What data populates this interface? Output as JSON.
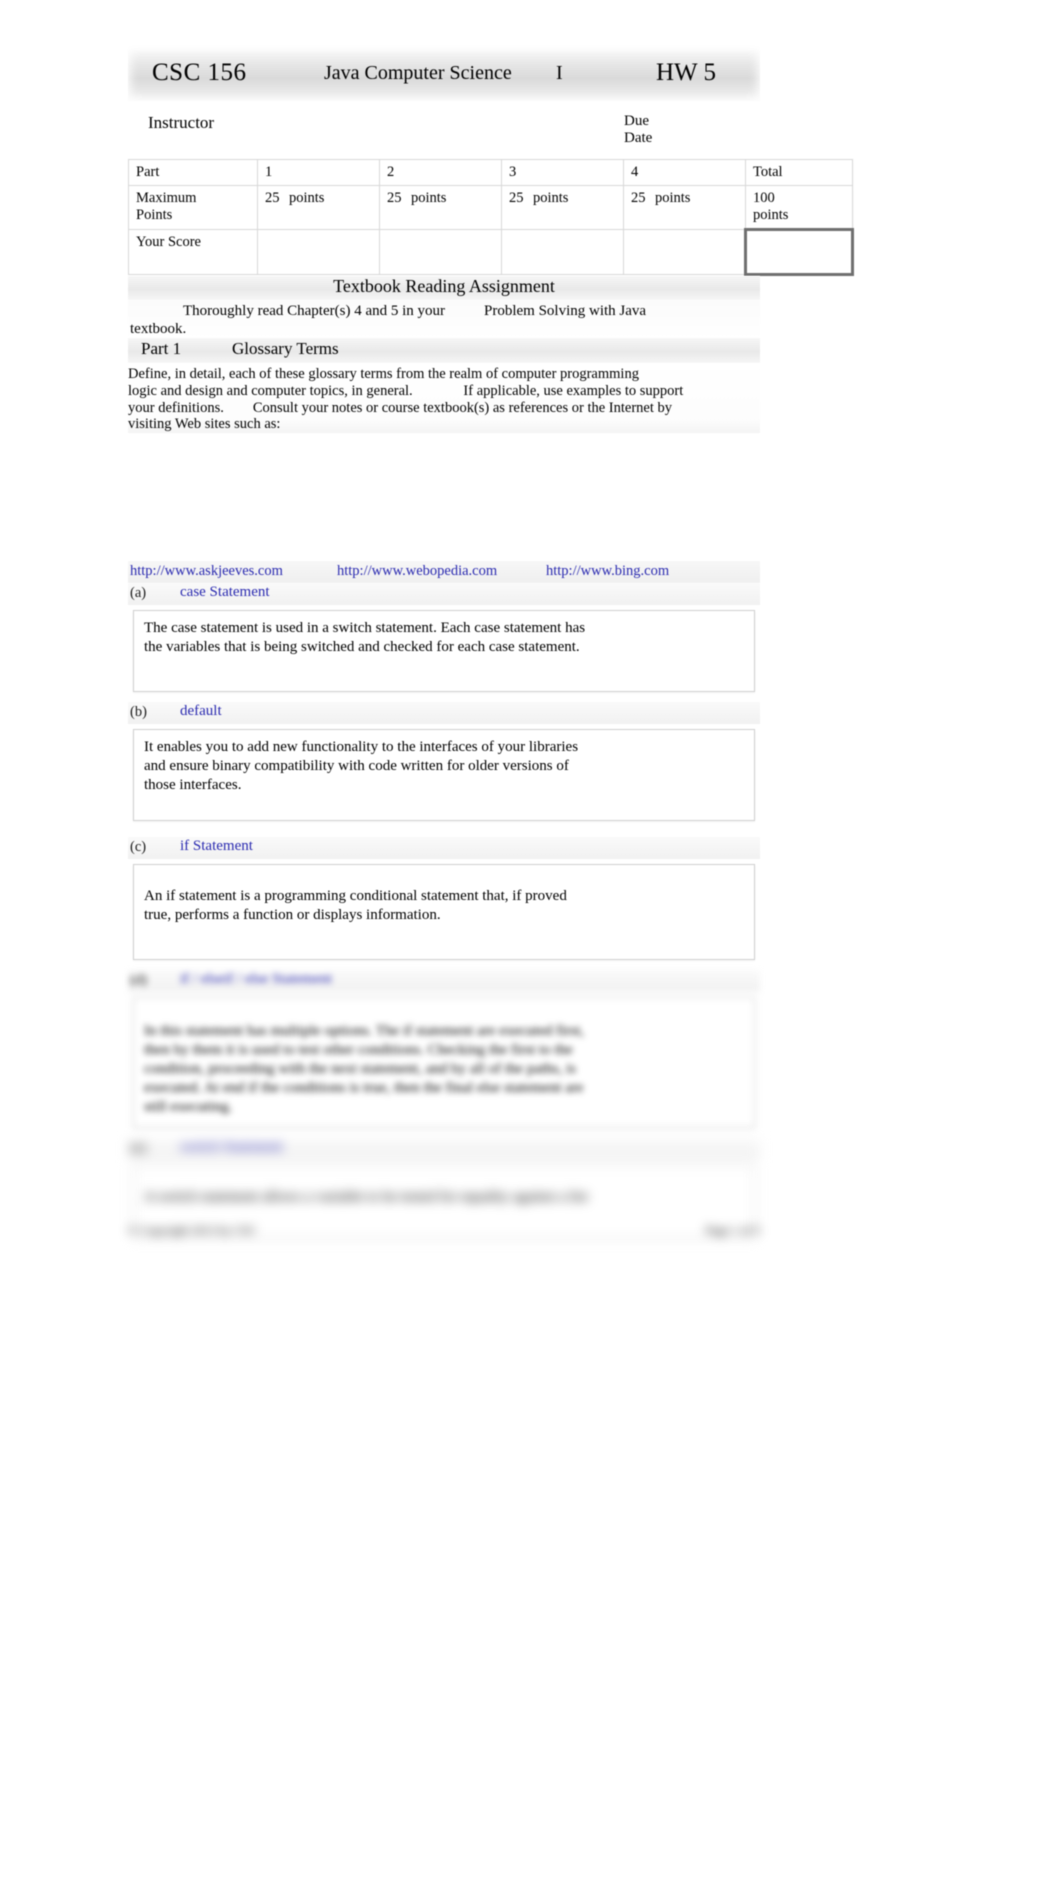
{
  "header": {
    "course_code": "CSC 156",
    "course_name": "Java Computer Science",
    "course_number": "I",
    "assignment": "HW 5"
  },
  "info": {
    "instructor_label": "Instructor",
    "due_label_line1": "Due",
    "due_label_line2": "Date"
  },
  "score_table": {
    "row_part_label": "Part",
    "row_max_label_line1": "Maximum",
    "row_max_label_line2": "Points",
    "row_your_score_label": "Your Score",
    "parts": [
      "1",
      "2",
      "3",
      "4"
    ],
    "points_values": [
      "25",
      "25",
      "25",
      "25"
    ],
    "points_unit": "points",
    "total_label": "Total",
    "total_points_line1": "100",
    "total_points_line2": "points"
  },
  "reading": {
    "banner": "Textbook Reading Assignment",
    "line1": "Thoroughly read Chapter(s) 4 and 5 in your",
    "book_title": "Problem Solving with Java",
    "line2": "textbook."
  },
  "part1": {
    "banner_left": "Part 1",
    "banner_mid": "Glossary Terms",
    "instructions_line1": "Define, in detail, each of these glossary terms from the realm of computer programming",
    "instructions_line2": "logic and design and computer topics, in general.              If applicable, use examples to support",
    "instructions_line3": "your definitions.        Consult your notes or course textbook(s) as references or the Internet by",
    "instructions_line4": "visiting Web sites such as:"
  },
  "urls": [
    "http://www.askjeeves.com",
    "http://www.webopedia.com",
    "http://www.bing.com"
  ],
  "glossary": [
    {
      "letter": "(a)",
      "term": "case Statement",
      "answer_lines": [
        "The case statement is used in a switch statement. Each case statement has",
        "the variables that is being switched and checked for each case statement."
      ]
    },
    {
      "letter": "(b)",
      "term": "default",
      "answer_lines": [
        "It enables you to add new functionality to the interfaces of your libraries",
        "and ensure binary compatibility with code written for older versions of",
        "those interfaces."
      ]
    },
    {
      "letter": "(c)",
      "term": "if Statement",
      "answer_lines": [
        "An if statement is a programming conditional statement that, if proved",
        "true, performs a function or displays information."
      ]
    },
    {
      "letter": "(d)",
      "term": "if / elseif / else Statement",
      "answer_lines": [
        "In this statement has multiple options. The if statement are executed first,",
        "then by them it is used to test other conditions. Checking the first to the",
        "condition, proceeding with the next statement, and by all of the paths, is",
        "executed. At end if the conditions is true, then the final else statement are",
        "still executing."
      ]
    },
    {
      "letter": "(e)",
      "term": "switch Statement",
      "answer_lines": [
        "A switch statement allows a variable to be tested for equality against a list"
      ]
    }
  ],
  "footer": {
    "copyright": "© Copyright 2013 by CSC",
    "page": "Page 1 of 5"
  },
  "colors": {
    "link": "#2a2ab0",
    "banner": "#ececec",
    "border": "#d8d8d8"
  }
}
